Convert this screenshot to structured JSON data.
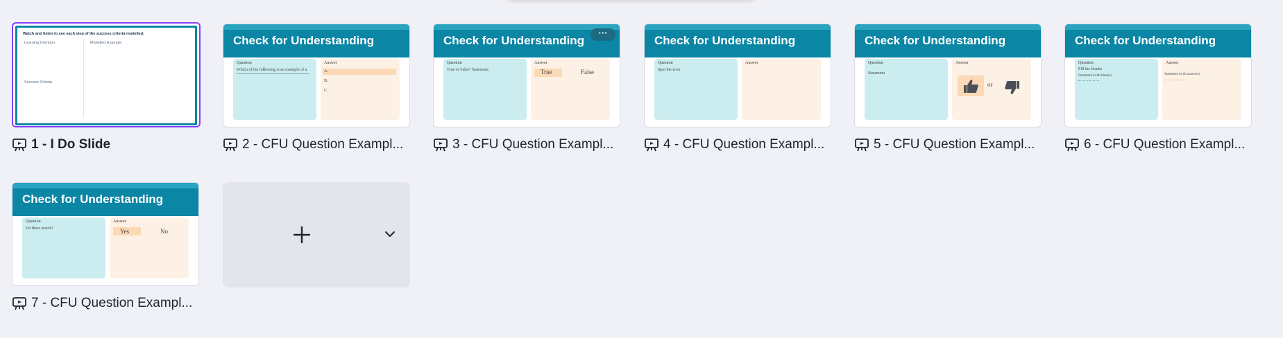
{
  "slides": [
    {
      "number": "1",
      "caption": "1 - I Do Slide",
      "selected": true,
      "content": {
        "top": "Watch and listen to see each step of the success criteria modelled.",
        "learning": "Learning Intention",
        "modelled": "Modelled Example",
        "success": "Success Criteria"
      }
    },
    {
      "number": "2",
      "caption": "2 - CFU Question Exampl...",
      "title": "Check for Understanding",
      "question_label": "Question",
      "answer_label": "Answer",
      "question_text": "Which of the following is an example of a",
      "answers": [
        "A.",
        "B.",
        "C."
      ]
    },
    {
      "number": "3",
      "caption": "3 - CFU Question Exampl...",
      "title": "Check for Understanding",
      "question_label": "Question",
      "answer_label": "Answer",
      "question_text": "True or False? Statement",
      "true_label": "True",
      "false_label": "False",
      "menu": "···"
    },
    {
      "number": "4",
      "caption": "4 - CFU Question Exampl...",
      "title": "Check for Understanding",
      "question_label": "Question",
      "answer_label": "Answer",
      "question_text": "Spot the error"
    },
    {
      "number": "5",
      "caption": "5 - CFU Question Exampl...",
      "title": "Check for Understanding",
      "question_label": "Question",
      "answer_label": "Answer",
      "question_text": "Statement",
      "or_label": "or"
    },
    {
      "number": "6",
      "caption": "6 - CFU Question Exampl...",
      "title": "Check for Understanding",
      "question_label": "Question",
      "answer_label": "Answer",
      "question_text": "Fill the blanks",
      "question_sub": "Statement (with blanks)",
      "answer_text": "Statement (with answers)"
    },
    {
      "number": "7",
      "caption": "7 - CFU Question Exampl...",
      "title": "Check for Understanding",
      "question_label": "Question",
      "answer_label": "Answer",
      "question_text": "Do these match?",
      "yes_label": "Yes",
      "no_label": "No"
    }
  ],
  "add_page": {
    "icon": "plus-icon",
    "dropdown_icon": "chevron-down-icon"
  },
  "colors": {
    "accent": "#0b86a5",
    "selected": "#8b3dff",
    "question_bg": "#cbedef",
    "answer_bg": "#fdf1e6"
  }
}
